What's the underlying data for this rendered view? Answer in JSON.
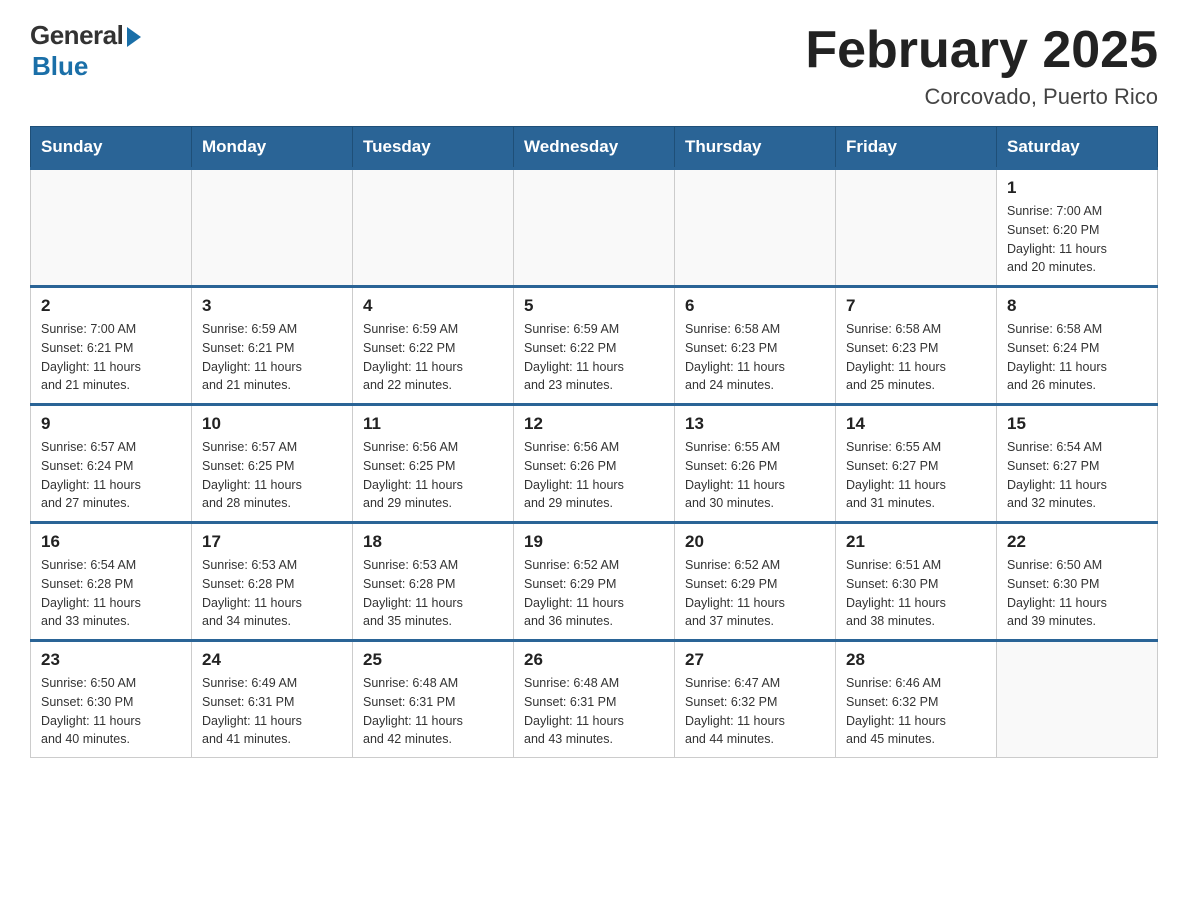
{
  "logo": {
    "general": "General",
    "blue": "Blue"
  },
  "title": "February 2025",
  "subtitle": "Corcovado, Puerto Rico",
  "days_of_week": [
    "Sunday",
    "Monday",
    "Tuesday",
    "Wednesday",
    "Thursday",
    "Friday",
    "Saturday"
  ],
  "weeks": [
    [
      {
        "day": "",
        "info": ""
      },
      {
        "day": "",
        "info": ""
      },
      {
        "day": "",
        "info": ""
      },
      {
        "day": "",
        "info": ""
      },
      {
        "day": "",
        "info": ""
      },
      {
        "day": "",
        "info": ""
      },
      {
        "day": "1",
        "info": "Sunrise: 7:00 AM\nSunset: 6:20 PM\nDaylight: 11 hours\nand 20 minutes."
      }
    ],
    [
      {
        "day": "2",
        "info": "Sunrise: 7:00 AM\nSunset: 6:21 PM\nDaylight: 11 hours\nand 21 minutes."
      },
      {
        "day": "3",
        "info": "Sunrise: 6:59 AM\nSunset: 6:21 PM\nDaylight: 11 hours\nand 21 minutes."
      },
      {
        "day": "4",
        "info": "Sunrise: 6:59 AM\nSunset: 6:22 PM\nDaylight: 11 hours\nand 22 minutes."
      },
      {
        "day": "5",
        "info": "Sunrise: 6:59 AM\nSunset: 6:22 PM\nDaylight: 11 hours\nand 23 minutes."
      },
      {
        "day": "6",
        "info": "Sunrise: 6:58 AM\nSunset: 6:23 PM\nDaylight: 11 hours\nand 24 minutes."
      },
      {
        "day": "7",
        "info": "Sunrise: 6:58 AM\nSunset: 6:23 PM\nDaylight: 11 hours\nand 25 minutes."
      },
      {
        "day": "8",
        "info": "Sunrise: 6:58 AM\nSunset: 6:24 PM\nDaylight: 11 hours\nand 26 minutes."
      }
    ],
    [
      {
        "day": "9",
        "info": "Sunrise: 6:57 AM\nSunset: 6:24 PM\nDaylight: 11 hours\nand 27 minutes."
      },
      {
        "day": "10",
        "info": "Sunrise: 6:57 AM\nSunset: 6:25 PM\nDaylight: 11 hours\nand 28 minutes."
      },
      {
        "day": "11",
        "info": "Sunrise: 6:56 AM\nSunset: 6:25 PM\nDaylight: 11 hours\nand 29 minutes."
      },
      {
        "day": "12",
        "info": "Sunrise: 6:56 AM\nSunset: 6:26 PM\nDaylight: 11 hours\nand 29 minutes."
      },
      {
        "day": "13",
        "info": "Sunrise: 6:55 AM\nSunset: 6:26 PM\nDaylight: 11 hours\nand 30 minutes."
      },
      {
        "day": "14",
        "info": "Sunrise: 6:55 AM\nSunset: 6:27 PM\nDaylight: 11 hours\nand 31 minutes."
      },
      {
        "day": "15",
        "info": "Sunrise: 6:54 AM\nSunset: 6:27 PM\nDaylight: 11 hours\nand 32 minutes."
      }
    ],
    [
      {
        "day": "16",
        "info": "Sunrise: 6:54 AM\nSunset: 6:28 PM\nDaylight: 11 hours\nand 33 minutes."
      },
      {
        "day": "17",
        "info": "Sunrise: 6:53 AM\nSunset: 6:28 PM\nDaylight: 11 hours\nand 34 minutes."
      },
      {
        "day": "18",
        "info": "Sunrise: 6:53 AM\nSunset: 6:28 PM\nDaylight: 11 hours\nand 35 minutes."
      },
      {
        "day": "19",
        "info": "Sunrise: 6:52 AM\nSunset: 6:29 PM\nDaylight: 11 hours\nand 36 minutes."
      },
      {
        "day": "20",
        "info": "Sunrise: 6:52 AM\nSunset: 6:29 PM\nDaylight: 11 hours\nand 37 minutes."
      },
      {
        "day": "21",
        "info": "Sunrise: 6:51 AM\nSunset: 6:30 PM\nDaylight: 11 hours\nand 38 minutes."
      },
      {
        "day": "22",
        "info": "Sunrise: 6:50 AM\nSunset: 6:30 PM\nDaylight: 11 hours\nand 39 minutes."
      }
    ],
    [
      {
        "day": "23",
        "info": "Sunrise: 6:50 AM\nSunset: 6:30 PM\nDaylight: 11 hours\nand 40 minutes."
      },
      {
        "day": "24",
        "info": "Sunrise: 6:49 AM\nSunset: 6:31 PM\nDaylight: 11 hours\nand 41 minutes."
      },
      {
        "day": "25",
        "info": "Sunrise: 6:48 AM\nSunset: 6:31 PM\nDaylight: 11 hours\nand 42 minutes."
      },
      {
        "day": "26",
        "info": "Sunrise: 6:48 AM\nSunset: 6:31 PM\nDaylight: 11 hours\nand 43 minutes."
      },
      {
        "day": "27",
        "info": "Sunrise: 6:47 AM\nSunset: 6:32 PM\nDaylight: 11 hours\nand 44 minutes."
      },
      {
        "day": "28",
        "info": "Sunrise: 6:46 AM\nSunset: 6:32 PM\nDaylight: 11 hours\nand 45 minutes."
      },
      {
        "day": "",
        "info": ""
      }
    ]
  ]
}
